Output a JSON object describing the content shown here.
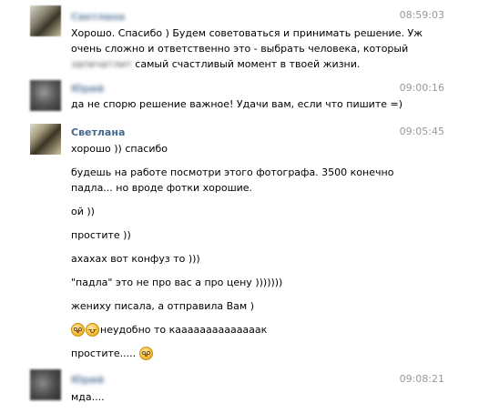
{
  "messages": [
    {
      "author": "Светлана",
      "time": "08:59:03",
      "lines": [
        "Хорошо. Спасибо ) Будем советоваться и принимать решение. Уж",
        "очень сложно и ответственно это - выбрать человека, который",
        "запечатлит самый счастливый момент в твоей жизни."
      ]
    },
    {
      "author": "Юрий",
      "time": "09:00:16",
      "lines": [
        "да не спорю решение важное! Удачи вам, если что пишите =)"
      ]
    },
    {
      "author": "Светлана",
      "time": "09:05:45",
      "lines": [
        "хорошо )) спасибо",
        "будешь на работе посмотри этого фотографа. 3500 конечно",
        "падла... но вроде фотки хорошие.",
        "ой ))",
        "простите ))",
        "ахахах вот конфуз то )))",
        "\"падла\" это не про вас а про цену )))))))",
        "жениху писала, а отправила Вам )",
        "неудобно то каааааааааааааак",
        "простите....."
      ]
    },
    {
      "author": "Юрий",
      "time": "09:08:21",
      "lines": [
        "мда...."
      ]
    }
  ],
  "icons": {
    "emoji_1": "flushed-face-icon",
    "emoji_2": "relieved-face-icon",
    "emoji_3": "flushed-face-icon"
  },
  "colors": {
    "author_name": "#45688e",
    "timestamp": "#999999",
    "text": "#000000"
  }
}
